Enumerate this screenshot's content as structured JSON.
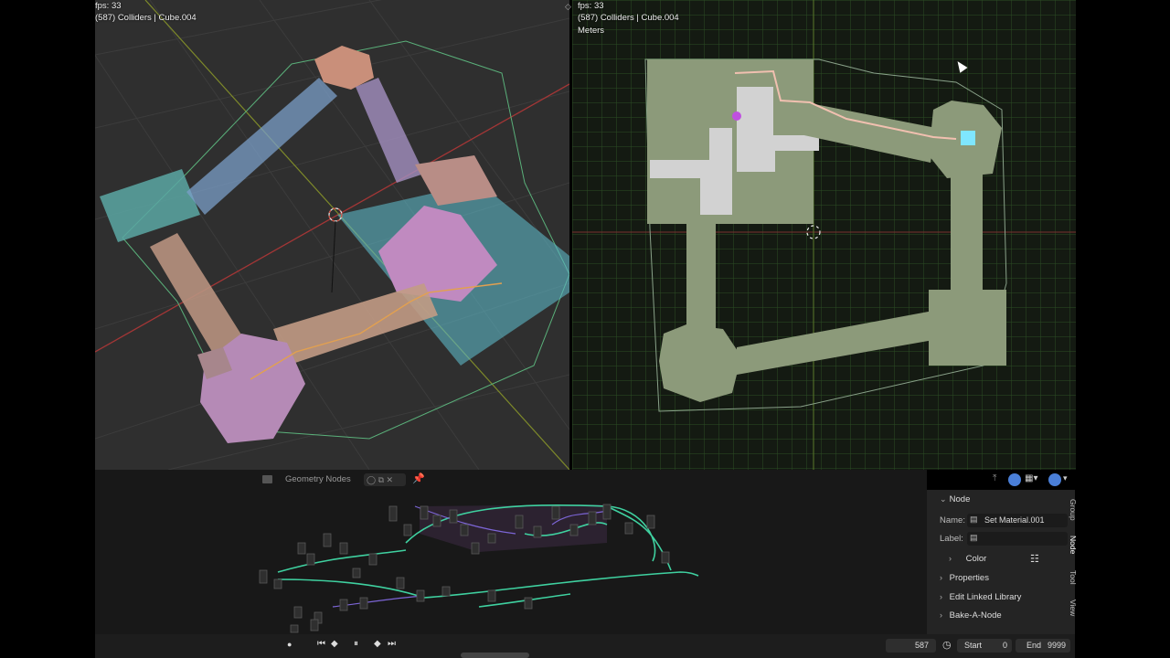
{
  "viewport_left": {
    "fps": "fps: 33",
    "info": "(587) Colliders | Cube.004"
  },
  "viewport_right": {
    "fps": "fps: 33",
    "info": "(587) Colliders | Cube.004",
    "units": "Meters"
  },
  "node_editor": {
    "title": "Geometry Nodes"
  },
  "properties": {
    "section_node": "Node",
    "name_label": "Name:",
    "name_value": "Set Material.001",
    "label_label": "Label:",
    "label_value": "",
    "color_label": "Color",
    "sections": [
      "Properties",
      "Edit Linked Library",
      "Bake-A-Node"
    ],
    "tabs": [
      "Group",
      "Node",
      "Tool",
      "View"
    ]
  },
  "timeline": {
    "current_frame": "587",
    "start_label": "Start",
    "start_value": "0",
    "end_label": "End",
    "end_value": "9999"
  },
  "colors": {
    "grid_green": "#3aa53a",
    "collider_teal": "#5bbfbf",
    "node_link": "#3fd1a0",
    "accent_blue": "#4a7fd8"
  }
}
